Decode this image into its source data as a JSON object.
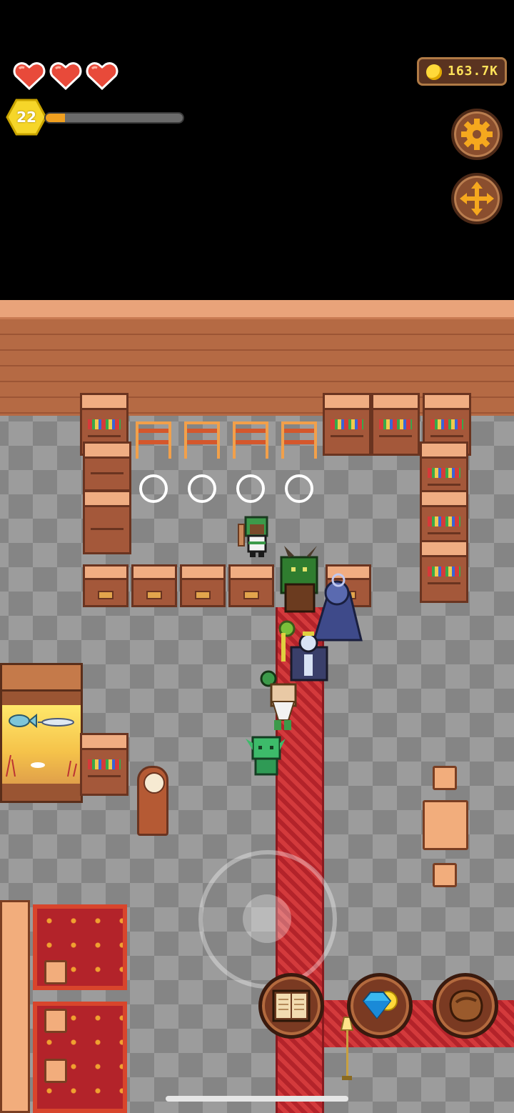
{
  "hud": {
    "hearts": 3,
    "level": "22",
    "xp_fraction": 0.14,
    "coins": "163.7K"
  },
  "icons": {
    "hearts": "heart-icon",
    "coin": "coin-icon",
    "settings": "gear-icon",
    "move": "move-arrows-icon",
    "book": "spellbook-icon",
    "shop": "gem-coin-icon",
    "bag": "leather-bag-icon"
  },
  "colors": {
    "heart": "#e84a3a",
    "level_badge": "#f6d629",
    "xp_fill": "#f0a020",
    "coin_text": "#ffe35a",
    "carpet": "#b3232a"
  }
}
